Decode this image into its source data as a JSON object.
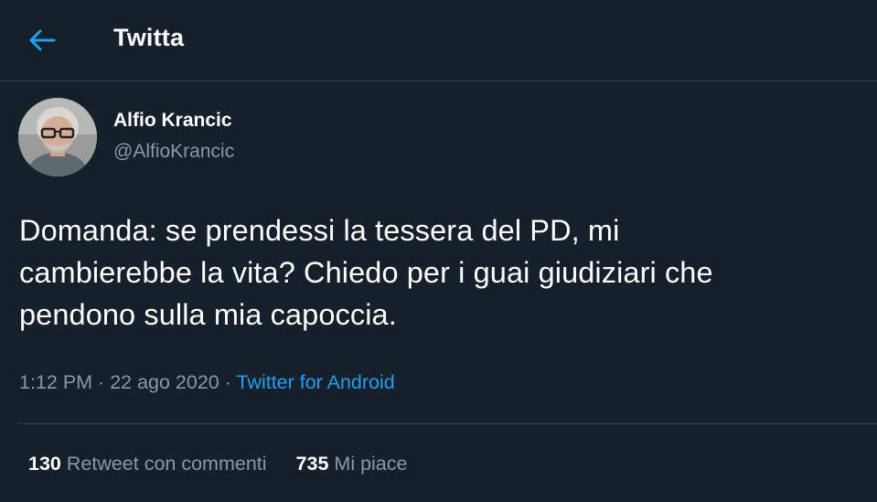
{
  "header": {
    "title": "Twitta",
    "back_icon": "arrow-left-icon"
  },
  "author": {
    "name": "Alfio Krancic",
    "handle": "@AlfioKrancic"
  },
  "tweet": {
    "line1": "Domanda: se prendessi la tessera del PD, mi",
    "line2": "cambierebbe la vita? Chiedo per i guai giudiziari che",
    "line3": "pendono sulla mia capoccia."
  },
  "meta": {
    "time": "1:12 PM",
    "sep1": " · ",
    "date": "22 ago 2020",
    "sep2": " · ",
    "source": "Twitter for Android"
  },
  "stats": {
    "retweets_count": "130",
    "retweets_label": "Retweet con commenti",
    "likes_count": "735",
    "likes_label": "Mi piace"
  },
  "colors": {
    "background": "#15202b",
    "accent": "#1da1f2",
    "secondary_text": "#8899a6",
    "divider": "#38444d"
  }
}
